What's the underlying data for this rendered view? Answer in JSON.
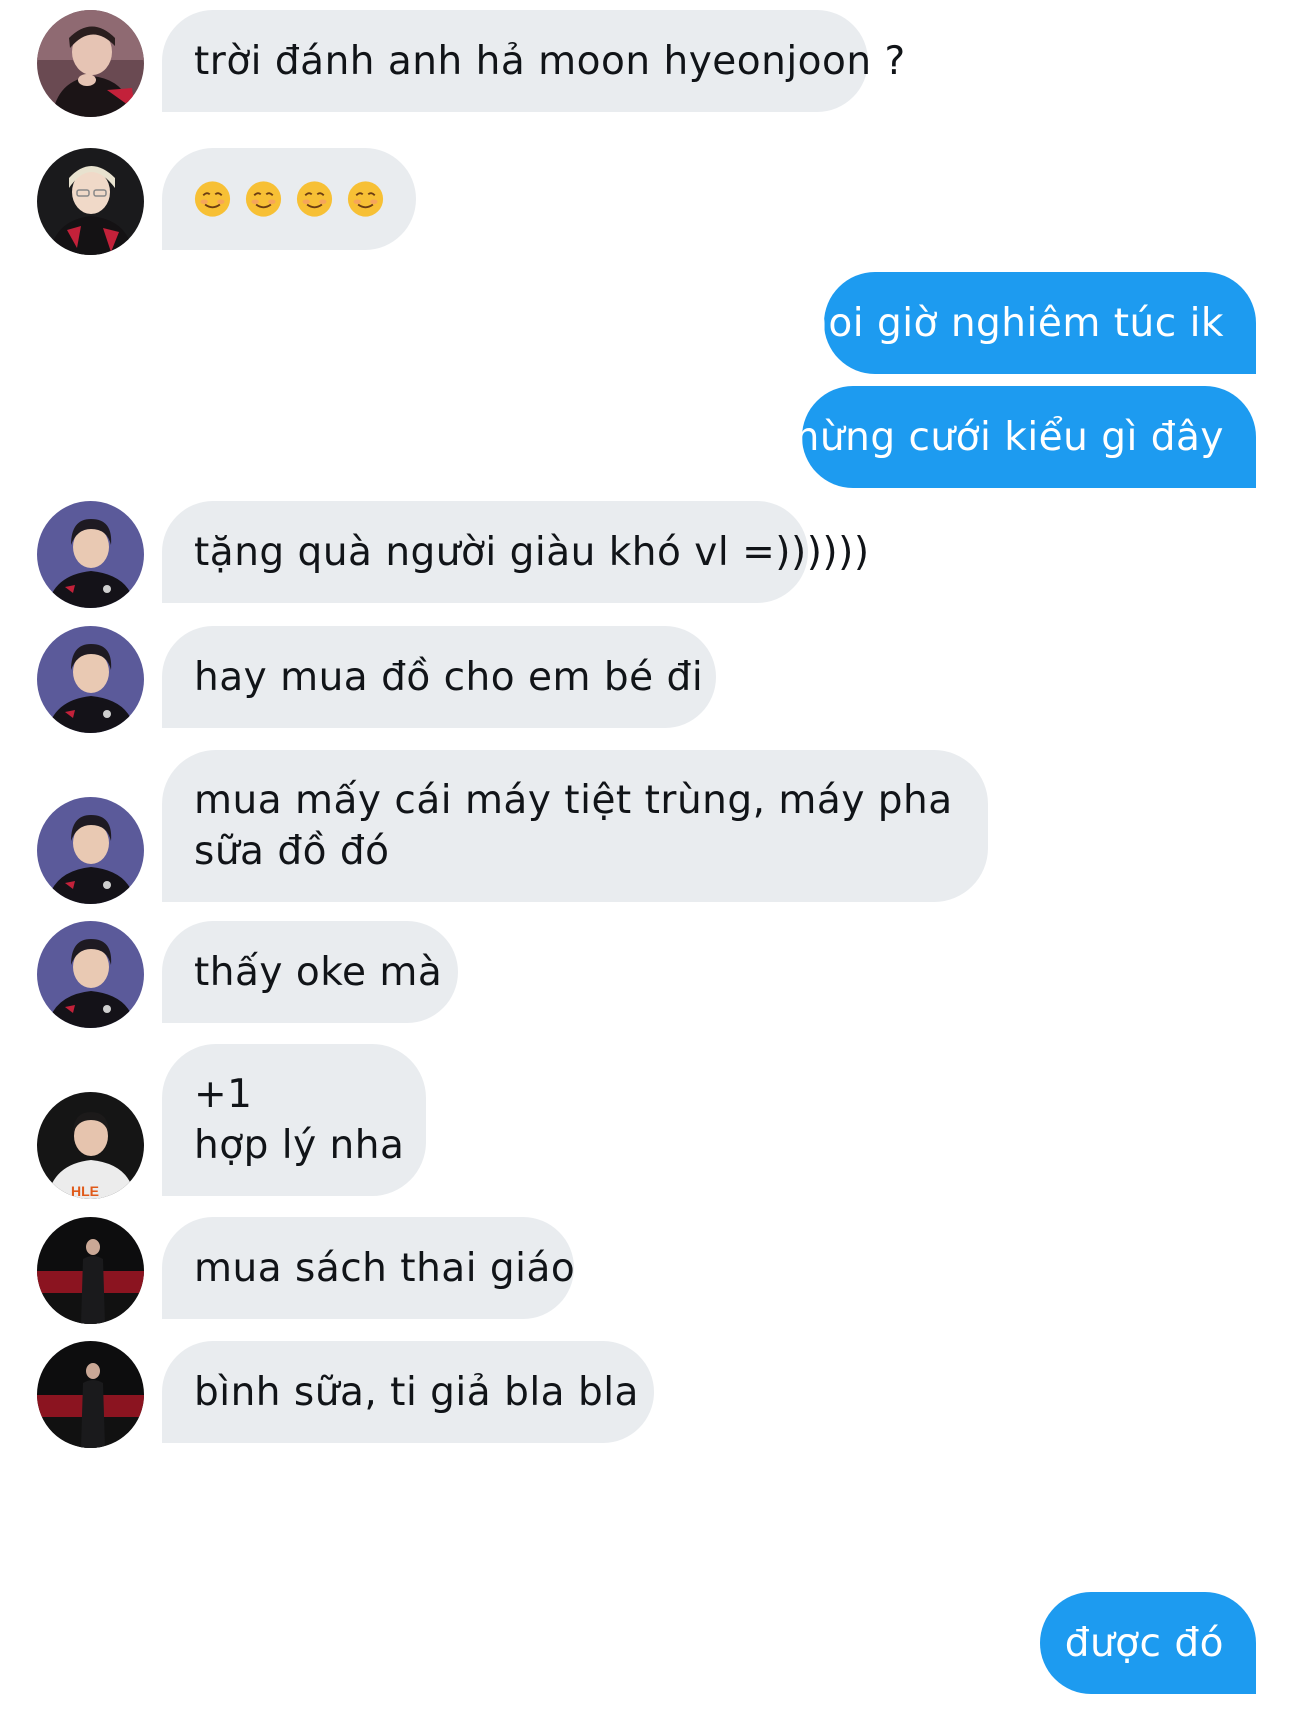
{
  "messages": [
    {
      "side": "in",
      "avatar": "red-team-player-avatar",
      "lines": [
        "trời đánh anh hả moon hyeonjoon ?"
      ]
    },
    {
      "side": "in",
      "avatar": "blond-player-avatar",
      "emoji": "☺️☺️☺️☺️",
      "emoji_name": "smiling-face-icon",
      "emoji_count": 4
    },
    {
      "side": "out",
      "lines": [
        "hoi giờ nghiêm túc ik"
      ]
    },
    {
      "side": "out",
      "lines": [
        "mừng cưới kiểu gì đây"
      ]
    },
    {
      "side": "in",
      "avatar": "purple-bg-player-avatar",
      "lines": [
        "tặng quà người giàu khó vl =))))))"
      ]
    },
    {
      "side": "in",
      "avatar": "purple-bg-player-avatar",
      "lines": [
        "hay mua đồ cho em bé đi"
      ]
    },
    {
      "side": "in",
      "avatar": "purple-bg-player-avatar",
      "lines": [
        "mua mấy cái máy tiệt trùng, máy pha",
        "sữa đồ đó"
      ]
    },
    {
      "side": "in",
      "avatar": "purple-bg-player-avatar",
      "lines": [
        "thấy oke mà"
      ]
    },
    {
      "side": "in",
      "avatar": "hle-player-avatar",
      "lines": [
        "+1",
        "hợp lý nha"
      ]
    },
    {
      "side": "in",
      "avatar": "dark-stage-player-avatar",
      "lines": [
        "mua sách thai giáo"
      ]
    },
    {
      "side": "in",
      "avatar": "dark-stage-player-avatar",
      "lines": [
        "bình sữa, ti giả bla bla"
      ]
    },
    {
      "side": "out",
      "lines": [
        "được đó"
      ]
    }
  ],
  "colors": {
    "incoming_bubble": "#e9ecef",
    "outgoing_bubble": "#1d9bf0",
    "incoming_text": "#111418",
    "outgoing_text": "#ffffff"
  }
}
